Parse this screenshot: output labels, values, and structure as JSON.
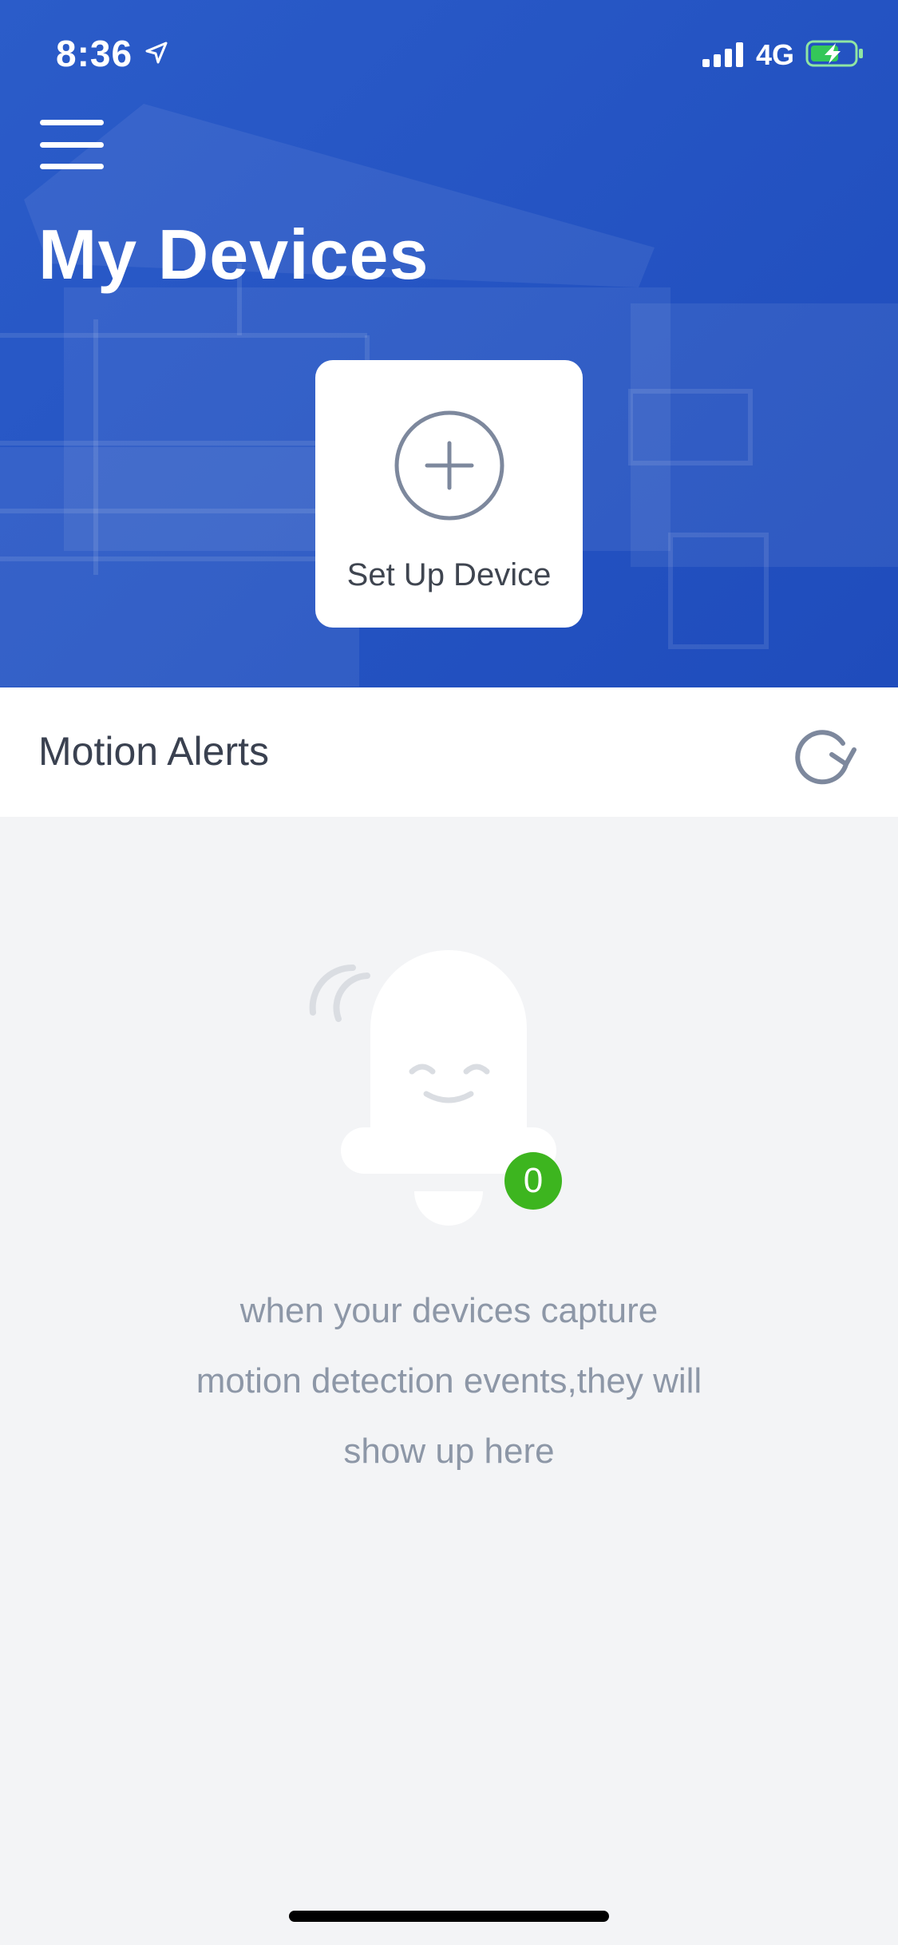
{
  "status_bar": {
    "time": "8:36",
    "network": "4G",
    "icons": [
      "location-arrow-icon",
      "signal-icon",
      "battery-charging-icon"
    ]
  },
  "header": {
    "title": "My Devices",
    "menu_icon": "hamburger-menu-icon"
  },
  "setup_card": {
    "label": "Set Up Device",
    "icon": "plus-circle-icon"
  },
  "motion_alerts": {
    "title": "Motion Alerts",
    "refresh_icon": "refresh-icon",
    "badge_count": "0",
    "empty_message": "when your  devices capture\nmotion detection events,they will\nshow up here",
    "illustration_icon": "bell-icon"
  },
  "colors": {
    "header_blue": "#2453c2",
    "badge_green": "#3db51f",
    "page_background": "#f3f4f6"
  }
}
